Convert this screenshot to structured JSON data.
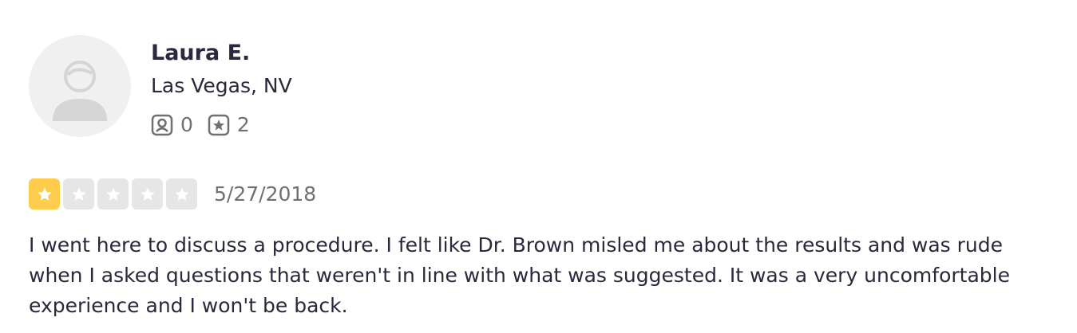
{
  "review": {
    "user": {
      "name": "Laura E.",
      "location": "Las Vegas, NV",
      "friends_count": "0",
      "reviews_count": "2",
      "avatar_icon": "default-user-avatar-icon"
    },
    "rating": {
      "value": 1,
      "max": 5,
      "filled_color": "#ffcc4b",
      "empty_color": "#e6e6e6"
    },
    "date": "5/27/2018",
    "text": "I went here to discuss a procedure. I felt like Dr. Brown misled me about the results and was rude when I asked questions that weren't in line with what was suggested. It was a very uncomfortable experience and I won't be back."
  },
  "icons": {
    "friends": "friends-icon",
    "reviews": "review-star-icon",
    "star": "star-icon"
  }
}
